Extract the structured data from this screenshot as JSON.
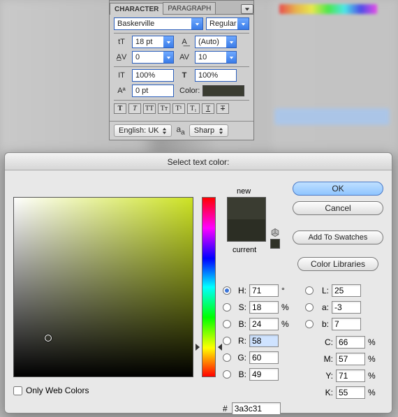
{
  "char_panel": {
    "tabs": {
      "character": "CHARACTER",
      "paragraph": "PARAGRAPH"
    },
    "font_family": "Baskerville",
    "font_style": "Regular",
    "size": "18 pt",
    "leading": "(Auto)",
    "kerning": "0",
    "tracking": "10",
    "vscale": "100%",
    "hscale": "100%",
    "baseline": "0 pt",
    "color_label": "Color:",
    "swatch_hex": "#3a3c31",
    "type_buttons": [
      "T",
      "T",
      "TT",
      "Tr",
      "T¹",
      "T₁",
      "T",
      "Ŧ"
    ],
    "language": "English: UK",
    "aa": "Sharp"
  },
  "dialog": {
    "title": "Select text color:",
    "new_label": "new",
    "current_label": "current",
    "buttons": {
      "ok": "OK",
      "cancel": "Cancel",
      "add": "Add To Swatches",
      "libraries": "Color Libraries"
    },
    "web_only": "Only Web Colors",
    "hsb": {
      "H": "71",
      "S": "18",
      "B": "24"
    },
    "rgb": {
      "R": "58",
      "G": "60",
      "B": "49"
    },
    "lab": {
      "L": "25",
      "a": "-3",
      "b": "7"
    },
    "cmyk": {
      "C": "66",
      "M": "57",
      "Y": "71",
      "K": "55"
    },
    "hex": "3a3c31",
    "units": {
      "degree": "°",
      "percent": "%"
    }
  }
}
